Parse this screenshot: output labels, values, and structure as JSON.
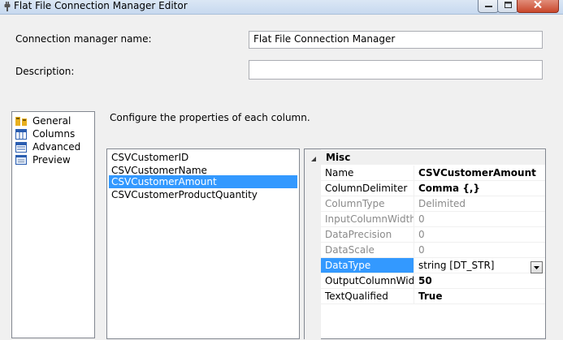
{
  "window": {
    "title": "Flat File Connection Manager Editor",
    "icons": {
      "app": "connection-plug-icon",
      "minimize": "minimize-icon",
      "maximize": "maximize-icon",
      "close": "close-icon"
    }
  },
  "form": {
    "name_label": "Connection manager name:",
    "name_value": "Flat File Connection Manager",
    "description_label": "Description:",
    "description_value": "",
    "instruction": "Configure the properties of each column."
  },
  "nav": {
    "items": [
      {
        "label": "General",
        "icon": "general-icon"
      },
      {
        "label": "Columns",
        "icon": "columns-icon"
      },
      {
        "label": "Advanced",
        "icon": "advanced-icon",
        "selected": true
      },
      {
        "label": "Preview",
        "icon": "preview-icon"
      }
    ]
  },
  "columns": {
    "items": [
      {
        "label": "CSVCustomerID"
      },
      {
        "label": "CSVCustomerName"
      },
      {
        "label": "CSVCustomerAmount",
        "selected": true
      },
      {
        "label": "CSVCustomerProductQuantity"
      }
    ]
  },
  "properties": {
    "category": "Misc",
    "rows": [
      {
        "name": "Name",
        "value": "CSVCustomerAmount",
        "bold": true,
        "readonly": false
      },
      {
        "name": "ColumnDelimiter",
        "value": "Comma {,}",
        "bold": true,
        "readonly": false
      },
      {
        "name": "ColumnType",
        "value": "Delimited",
        "bold": false,
        "readonly": true
      },
      {
        "name": "InputColumnWidth",
        "value": "0",
        "bold": false,
        "readonly": true
      },
      {
        "name": "DataPrecision",
        "value": "0",
        "bold": false,
        "readonly": true
      },
      {
        "name": "DataScale",
        "value": "0",
        "bold": false,
        "readonly": true
      },
      {
        "name": "DataType",
        "value": "string [DT_STR]",
        "bold": false,
        "readonly": false,
        "selected": true
      },
      {
        "name": "OutputColumnWidth",
        "value": "50",
        "bold": true,
        "readonly": false
      },
      {
        "name": "TextQualified",
        "value": "True",
        "bold": true,
        "readonly": false
      }
    ]
  },
  "colors": {
    "selection": "#3399ff",
    "window_bg": "#f0f0f0",
    "readonly_text": "#8a8a8a"
  }
}
